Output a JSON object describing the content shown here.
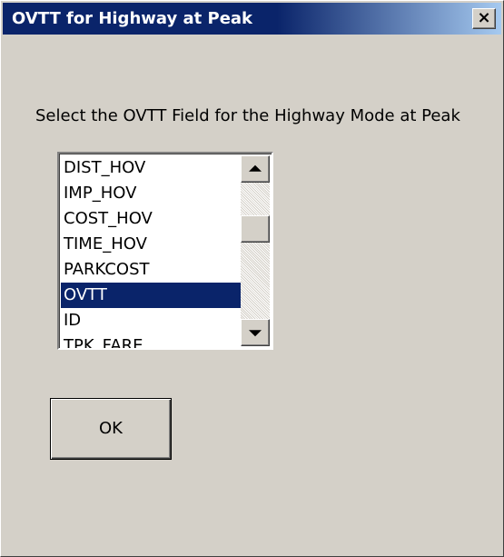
{
  "window": {
    "title": "OVTT for Highway at Peak",
    "close_glyph": "×",
    "titlebar_color": "#0a246a"
  },
  "prompt": "Select the OVTT Field for the Highway Mode at Peak",
  "field_list": {
    "items": [
      {
        "label": "DIST_HOV",
        "selected": false
      },
      {
        "label": "IMP_HOV",
        "selected": false
      },
      {
        "label": "COST_HOV",
        "selected": false
      },
      {
        "label": "TIME_HOV",
        "selected": false
      },
      {
        "label": "PARKCOST",
        "selected": false
      },
      {
        "label": "OVTT",
        "selected": true
      },
      {
        "label": "ID",
        "selected": false
      },
      {
        "label": "TPK_FARE",
        "selected": false
      }
    ],
    "selected_value": "OVTT",
    "selection_color": "#0a246a"
  },
  "buttons": {
    "ok_label": "OK"
  }
}
